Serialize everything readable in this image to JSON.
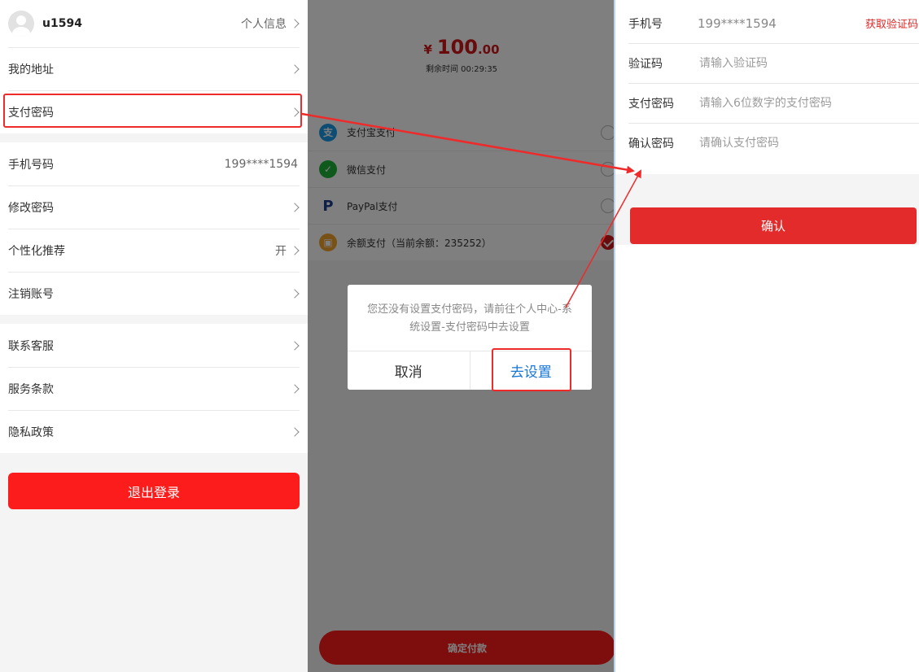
{
  "left": {
    "username": "u1594",
    "profile_label": "个人信息",
    "items": {
      "address": "我的地址",
      "pay_password": "支付密码",
      "phone": "手机号码",
      "phone_value": "199****1594",
      "change_password": "修改密码",
      "recommend": "个性化推荐",
      "recommend_value": "开",
      "cancel_account": "注销账号",
      "contact": "联系客服",
      "terms": "服务条款",
      "privacy": "隐私政策"
    },
    "logout": "退出登录"
  },
  "middle": {
    "currency": "¥",
    "amount_int": "100",
    "amount_dec": ".00",
    "remaining": "剩余时间 00:29:35",
    "methods": [
      {
        "label": "支付宝支付",
        "selected": false,
        "icon": "alipay-icon",
        "color": "#1a9be6"
      },
      {
        "label": "微信支付",
        "selected": false,
        "icon": "wechat-pay-icon",
        "color": "#1fb23a"
      },
      {
        "label": "PayPal支付",
        "selected": false,
        "icon": "paypal-icon",
        "color": "#1a3f8f"
      },
      {
        "label": "余额支付（当前余额：235252）",
        "selected": true,
        "icon": "wallet-icon",
        "color": "#f0a22d"
      }
    ],
    "confirm_pay": "确定付款",
    "dialog": {
      "message": "您还没有设置支付密码，请前往个人中心-系统设置-支付密码中去设置",
      "cancel": "取消",
      "go_set": "去设置"
    }
  },
  "right": {
    "phone_label": "手机号",
    "phone_value": "199****1594",
    "get_code": "获取验证码",
    "code_label": "验证码",
    "code_placeholder": "请输入验证码",
    "pay_pwd_label": "支付密码",
    "pay_pwd_placeholder": "请输入6位数字的支付密码",
    "confirm_pwd_label": "确认密码",
    "confirm_pwd_placeholder": "请确认支付密码",
    "confirm_button": "确认"
  },
  "colors": {
    "accent_red": "#fc1c1c",
    "price_red": "#d0161b",
    "dialog_link_blue": "#1777d4",
    "annotation_red": "#ee2a2a"
  }
}
